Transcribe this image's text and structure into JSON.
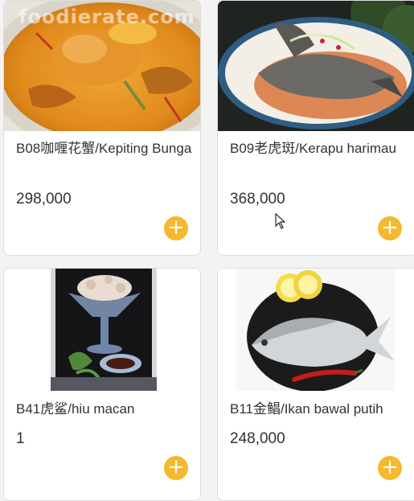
{
  "menu": {
    "items": [
      {
        "name": "B08咖喱花蟹/Kepiting Bunga",
        "price": "298,000",
        "image": "curry-crab-photo"
      },
      {
        "name": "B09老虎斑/Kerapu harimau",
        "price": "368,000",
        "image": "steamed-grouper-photo"
      },
      {
        "name": "B41虎鲨/hiu macan",
        "price": "1",
        "image": "tiger-shark-dessert-photo"
      },
      {
        "name": "B11金鲳/Ikan bawal putih",
        "price": "248,000",
        "image": "white-pomfret-photo"
      }
    ],
    "add_button_symbol": "+",
    "watermark": "foodierate.com"
  },
  "colors": {
    "accent": "#f5b82e",
    "card_bg": "#ffffff",
    "page_bg": "#f3f3f3",
    "text": "#333333"
  }
}
